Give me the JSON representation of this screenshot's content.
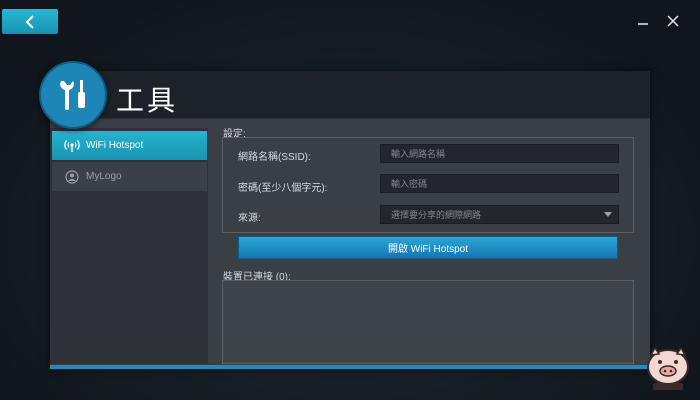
{
  "window": {
    "back_icon": "chevron-left-icon",
    "minimize_icon": "minimize-icon",
    "close_icon": "close-icon"
  },
  "header": {
    "title": "工具",
    "badge_icon": "wrench-screwdriver-icon",
    "badge_color": "#1e86b6"
  },
  "sidebar": {
    "items": [
      {
        "label": "WiFi Hotspot",
        "icon": "wifi-antenna-icon",
        "active": true
      },
      {
        "label": "MyLogo",
        "icon": "user-circle-icon",
        "active": false
      }
    ]
  },
  "settings": {
    "section_label": "設定:",
    "ssid_label": "網路名稱(SSID):",
    "ssid_placeholder": "輸入網路名稱",
    "password_label": "密碼(至少八個字元):",
    "password_placeholder": "輸入密碼",
    "source_label": "來源:",
    "source_placeholder": "選擇要分享的網際網路"
  },
  "action": {
    "hotspot_button": "開啟 WiFi Hotspot"
  },
  "devices": {
    "label": "裝置已連接 (0):"
  },
  "colors": {
    "accent": "#27b4d0",
    "button_blue": "#1a8ec4"
  }
}
